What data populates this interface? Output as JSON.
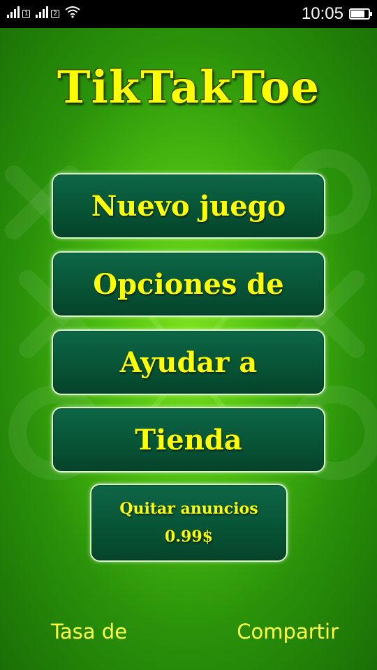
{
  "status_bar": {
    "sim1_label": "1",
    "sim2_label": "2",
    "time": "10:05",
    "battery_level": 0.8
  },
  "app": {
    "title": "TikTakToe",
    "menu": {
      "new_game": "Nuevo juego",
      "options": "Opciones de",
      "help": "Ayudar a",
      "store": "Tienda",
      "remove_ads_line1": "Quitar anuncios",
      "remove_ads_price": "0.99$"
    },
    "footer": {
      "rate": "Tasa de",
      "share": "Compartir"
    }
  },
  "colors": {
    "title_yellow": "#ffff00",
    "button_green": "#085638",
    "background_green": "#4fc011"
  },
  "icons": [
    "signal-icon",
    "wifi-icon",
    "battery-icon"
  ]
}
